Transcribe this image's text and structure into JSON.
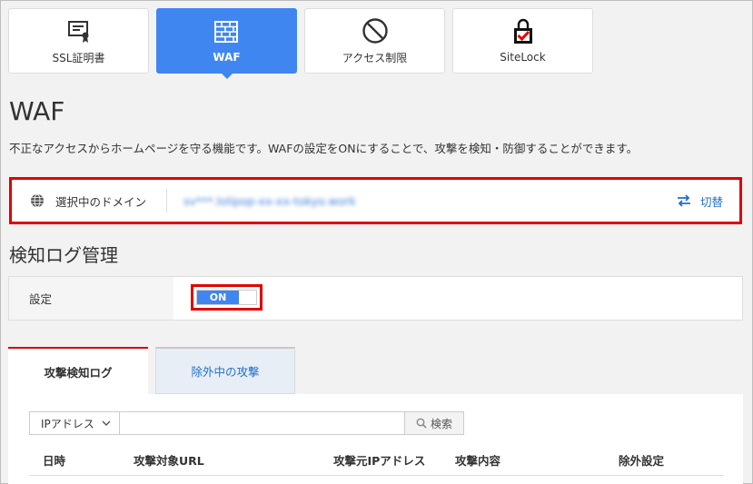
{
  "top_tabs": [
    {
      "label": "SSL証明書",
      "icon": "certificate-icon",
      "active": false
    },
    {
      "label": "WAF",
      "icon": "firewall-icon",
      "active": true
    },
    {
      "label": "アクセス制限",
      "icon": "prohibited-icon",
      "active": false
    },
    {
      "label": "SiteLock",
      "icon": "lock-check-icon",
      "active": false
    }
  ],
  "page": {
    "title": "WAF",
    "description": "不正なアクセスからホームページを守る機能です。WAFの設定をONにすることで、攻撃を検知・防御することができます。"
  },
  "domain": {
    "label": "選択中のドメイン",
    "value": "sv***.lolipop-xx-xx-tokyo.work",
    "switch_label": "切替"
  },
  "log_section": {
    "title": "検知ログ管理",
    "setting_label": "設定",
    "toggle_value": "ON"
  },
  "sub_tabs": [
    {
      "label": "攻撃検知ログ",
      "active": true
    },
    {
      "label": "除外中の攻撃",
      "active": false
    }
  ],
  "filter": {
    "select_value": "IPアドレス",
    "input_value": "",
    "search_label": "検索"
  },
  "table": {
    "headers": [
      "日時",
      "攻撃対象URL",
      "攻撃元IPアドレス",
      "攻撃内容",
      "除外設定"
    ]
  },
  "colors": {
    "accent": "#3f86f0",
    "highlight": "#e00000",
    "link": "#1f6fc9"
  }
}
